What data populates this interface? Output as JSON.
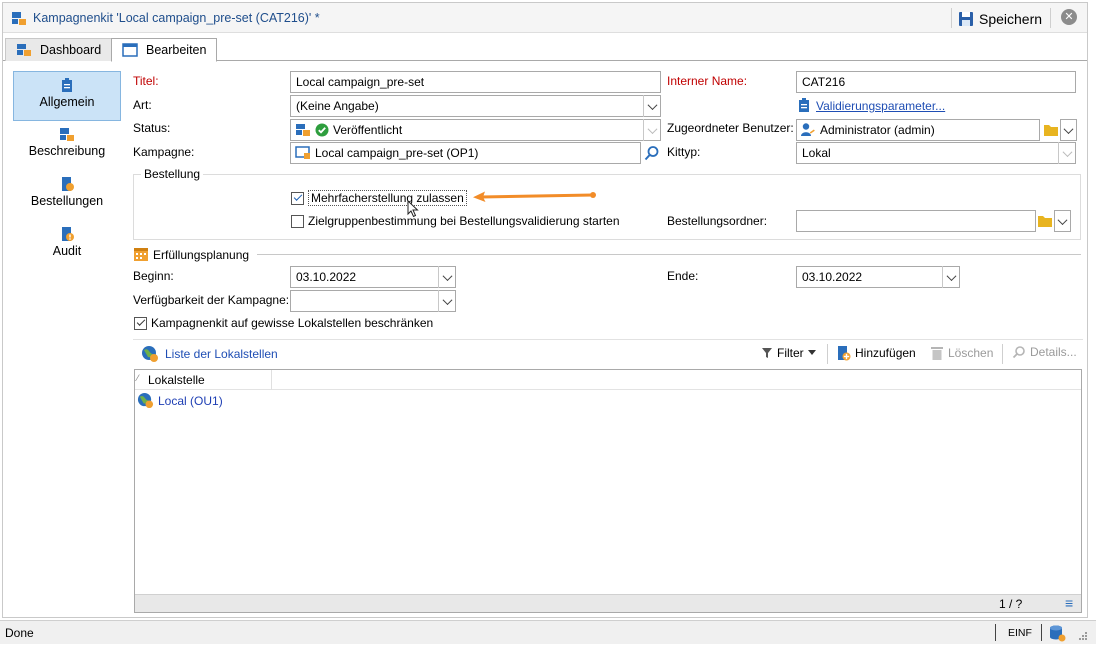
{
  "window": {
    "title": "Kampagnenkit 'Local campaign_pre-set (CAT216)' *",
    "save_label": "Speichern",
    "close_glyph": "✕"
  },
  "tabs": [
    {
      "label": "Dashboard",
      "active": false
    },
    {
      "label": "Bearbeiten",
      "active": true
    }
  ],
  "sidebar": {
    "items": [
      {
        "label": "Allgemein",
        "selected": true,
        "icon": "clipboard-icon"
      },
      {
        "label": "Beschreibung",
        "selected": false,
        "icon": "description-icon"
      },
      {
        "label": "Bestellungen",
        "selected": false,
        "icon": "orders-icon"
      },
      {
        "label": "Audit",
        "selected": false,
        "icon": "audit-icon"
      }
    ]
  },
  "form": {
    "titel_label": "Titel:",
    "titel_value": "Local campaign_pre-set",
    "interner_name_label": "Interner Name:",
    "interner_name_value": "CAT216",
    "art_label": "Art:",
    "art_value": "(Keine Angabe)",
    "validierung_link": "Validierungsparameter...",
    "status_label": "Status:",
    "status_value": "Veröffentlicht",
    "benutzer_label": "Zugeordneter Benutzer:",
    "benutzer_value": "Administrator (admin)",
    "kampagne_label": "Kampagne:",
    "kampagne_value": "Local campaign_pre-set (OP1)",
    "kittyp_label": "Kittyp:",
    "kittyp_value": "Lokal"
  },
  "bestellung": {
    "legend": "Bestellung",
    "mehrfach_label": "Mehrfacherstellung zulassen",
    "mehrfach_checked": true,
    "zielgruppen_label": "Zielgruppenbestimmung bei Bestellungsvalidierung starten",
    "zielgruppen_checked": false,
    "ordner_label": "Bestellungsordner:",
    "ordner_value": ""
  },
  "planung": {
    "legend": "Erfüllungsplanung",
    "beginn_label": "Beginn:",
    "beginn_value": "03.10.2022",
    "ende_label": "Ende:",
    "ende_value": "03.10.2022",
    "verfuegbarkeit_label": "Verfügbarkeit der Kampagne:",
    "verfuegbarkeit_value": "",
    "beschraenken_label": "Kampagnenkit auf gewisse Lokalstellen beschränken",
    "beschraenken_checked": true
  },
  "list_toolbar": {
    "title": "Liste der Lokalstellen",
    "filter": "Filter",
    "add": "Hinzufügen",
    "delete": "Löschen",
    "details": "Details..."
  },
  "grid": {
    "sort_glyph": "⁄",
    "column": "Lokalstelle",
    "rows": [
      "Local (OU1)"
    ],
    "pager": "1 / ?",
    "menu_glyph": "≡"
  },
  "statusbar": {
    "text": "Done",
    "mode": "EINF"
  },
  "colors": {
    "accent": "#1f4eb4",
    "required": "#c00000",
    "arrow": "#f28c28",
    "selected_bg": "#cbe3f7"
  }
}
